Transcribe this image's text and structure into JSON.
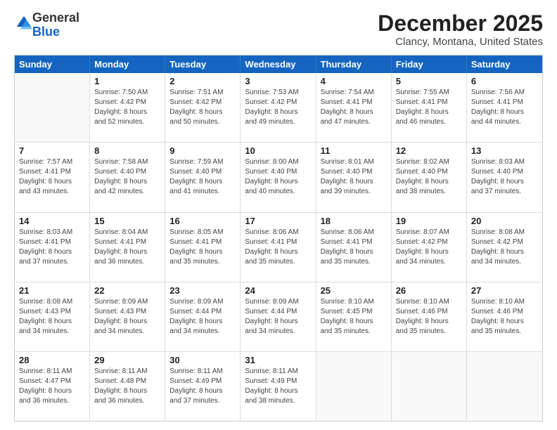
{
  "logo": {
    "general": "General",
    "blue": "Blue"
  },
  "title": "December 2025",
  "subtitle": "Clancy, Montana, United States",
  "days": [
    "Sunday",
    "Monday",
    "Tuesday",
    "Wednesday",
    "Thursday",
    "Friday",
    "Saturday"
  ],
  "weeks": [
    [
      {
        "day": "",
        "lines": []
      },
      {
        "day": "1",
        "lines": [
          "Sunrise: 7:50 AM",
          "Sunset: 4:42 PM",
          "Daylight: 8 hours",
          "and 52 minutes."
        ]
      },
      {
        "day": "2",
        "lines": [
          "Sunrise: 7:51 AM",
          "Sunset: 4:42 PM",
          "Daylight: 8 hours",
          "and 50 minutes."
        ]
      },
      {
        "day": "3",
        "lines": [
          "Sunrise: 7:53 AM",
          "Sunset: 4:42 PM",
          "Daylight: 8 hours",
          "and 49 minutes."
        ]
      },
      {
        "day": "4",
        "lines": [
          "Sunrise: 7:54 AM",
          "Sunset: 4:41 PM",
          "Daylight: 8 hours",
          "and 47 minutes."
        ]
      },
      {
        "day": "5",
        "lines": [
          "Sunrise: 7:55 AM",
          "Sunset: 4:41 PM",
          "Daylight: 8 hours",
          "and 46 minutes."
        ]
      },
      {
        "day": "6",
        "lines": [
          "Sunrise: 7:56 AM",
          "Sunset: 4:41 PM",
          "Daylight: 8 hours",
          "and 44 minutes."
        ]
      }
    ],
    [
      {
        "day": "7",
        "lines": [
          "Sunrise: 7:57 AM",
          "Sunset: 4:41 PM",
          "Daylight: 8 hours",
          "and 43 minutes."
        ]
      },
      {
        "day": "8",
        "lines": [
          "Sunrise: 7:58 AM",
          "Sunset: 4:40 PM",
          "Daylight: 8 hours",
          "and 42 minutes."
        ]
      },
      {
        "day": "9",
        "lines": [
          "Sunrise: 7:59 AM",
          "Sunset: 4:40 PM",
          "Daylight: 8 hours",
          "and 41 minutes."
        ]
      },
      {
        "day": "10",
        "lines": [
          "Sunrise: 8:00 AM",
          "Sunset: 4:40 PM",
          "Daylight: 8 hours",
          "and 40 minutes."
        ]
      },
      {
        "day": "11",
        "lines": [
          "Sunrise: 8:01 AM",
          "Sunset: 4:40 PM",
          "Daylight: 8 hours",
          "and 39 minutes."
        ]
      },
      {
        "day": "12",
        "lines": [
          "Sunrise: 8:02 AM",
          "Sunset: 4:40 PM",
          "Daylight: 8 hours",
          "and 38 minutes."
        ]
      },
      {
        "day": "13",
        "lines": [
          "Sunrise: 8:03 AM",
          "Sunset: 4:40 PM",
          "Daylight: 8 hours",
          "and 37 minutes."
        ]
      }
    ],
    [
      {
        "day": "14",
        "lines": [
          "Sunrise: 8:03 AM",
          "Sunset: 4:41 PM",
          "Daylight: 8 hours",
          "and 37 minutes."
        ]
      },
      {
        "day": "15",
        "lines": [
          "Sunrise: 8:04 AM",
          "Sunset: 4:41 PM",
          "Daylight: 8 hours",
          "and 36 minutes."
        ]
      },
      {
        "day": "16",
        "lines": [
          "Sunrise: 8:05 AM",
          "Sunset: 4:41 PM",
          "Daylight: 8 hours",
          "and 35 minutes."
        ]
      },
      {
        "day": "17",
        "lines": [
          "Sunrise: 8:06 AM",
          "Sunset: 4:41 PM",
          "Daylight: 8 hours",
          "and 35 minutes."
        ]
      },
      {
        "day": "18",
        "lines": [
          "Sunrise: 8:06 AM",
          "Sunset: 4:41 PM",
          "Daylight: 8 hours",
          "and 35 minutes."
        ]
      },
      {
        "day": "19",
        "lines": [
          "Sunrise: 8:07 AM",
          "Sunset: 4:42 PM",
          "Daylight: 8 hours",
          "and 34 minutes."
        ]
      },
      {
        "day": "20",
        "lines": [
          "Sunrise: 8:08 AM",
          "Sunset: 4:42 PM",
          "Daylight: 8 hours",
          "and 34 minutes."
        ]
      }
    ],
    [
      {
        "day": "21",
        "lines": [
          "Sunrise: 8:08 AM",
          "Sunset: 4:43 PM",
          "Daylight: 8 hours",
          "and 34 minutes."
        ]
      },
      {
        "day": "22",
        "lines": [
          "Sunrise: 8:09 AM",
          "Sunset: 4:43 PM",
          "Daylight: 8 hours",
          "and 34 minutes."
        ]
      },
      {
        "day": "23",
        "lines": [
          "Sunrise: 8:09 AM",
          "Sunset: 4:44 PM",
          "Daylight: 8 hours",
          "and 34 minutes."
        ]
      },
      {
        "day": "24",
        "lines": [
          "Sunrise: 8:09 AM",
          "Sunset: 4:44 PM",
          "Daylight: 8 hours",
          "and 34 minutes."
        ]
      },
      {
        "day": "25",
        "lines": [
          "Sunrise: 8:10 AM",
          "Sunset: 4:45 PM",
          "Daylight: 8 hours",
          "and 35 minutes."
        ]
      },
      {
        "day": "26",
        "lines": [
          "Sunrise: 8:10 AM",
          "Sunset: 4:46 PM",
          "Daylight: 8 hours",
          "and 35 minutes."
        ]
      },
      {
        "day": "27",
        "lines": [
          "Sunrise: 8:10 AM",
          "Sunset: 4:46 PM",
          "Daylight: 8 hours",
          "and 35 minutes."
        ]
      }
    ],
    [
      {
        "day": "28",
        "lines": [
          "Sunrise: 8:11 AM",
          "Sunset: 4:47 PM",
          "Daylight: 8 hours",
          "and 36 minutes."
        ]
      },
      {
        "day": "29",
        "lines": [
          "Sunrise: 8:11 AM",
          "Sunset: 4:48 PM",
          "Daylight: 8 hours",
          "and 36 minutes."
        ]
      },
      {
        "day": "30",
        "lines": [
          "Sunrise: 8:11 AM",
          "Sunset: 4:49 PM",
          "Daylight: 8 hours",
          "and 37 minutes."
        ]
      },
      {
        "day": "31",
        "lines": [
          "Sunrise: 8:11 AM",
          "Sunset: 4:49 PM",
          "Daylight: 8 hours",
          "and 38 minutes."
        ]
      },
      {
        "day": "",
        "lines": []
      },
      {
        "day": "",
        "lines": []
      },
      {
        "day": "",
        "lines": []
      }
    ]
  ]
}
